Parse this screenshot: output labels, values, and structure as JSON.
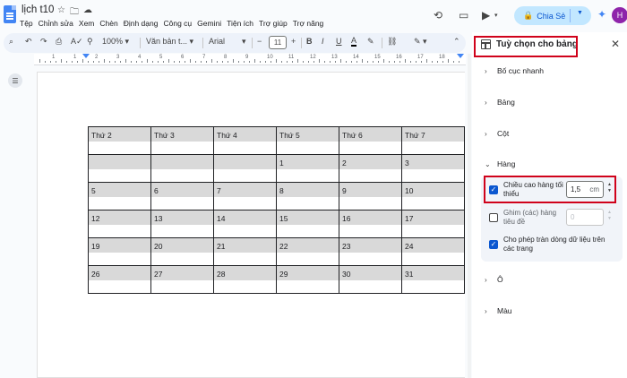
{
  "title_bar": {
    "doc_title": "lịch t10",
    "menus": [
      "Tệp",
      "Chỉnh sửa",
      "Xem",
      "Chèn",
      "Định dạng",
      "Công cụ",
      "Gemini",
      "Tiện ích",
      "Trợ giúp",
      "Trợ năng"
    ],
    "share_label": "Chia Sẻ",
    "avatar_letter": "H"
  },
  "toolbar": {
    "zoom": "100%",
    "style": "Văn bản t...",
    "font": "Arial",
    "font_size": "11",
    "minus": "−",
    "plus": "+"
  },
  "ruler": {
    "numbers": [
      "1",
      "1",
      "2",
      "3",
      "4",
      "5",
      "6",
      "7",
      "8",
      "9",
      "10",
      "11",
      "12",
      "13",
      "14",
      "15",
      "16",
      "17",
      "18"
    ]
  },
  "calendar": {
    "rows": [
      [
        "Thứ 2",
        "Thứ 3",
        "Thứ 4",
        "Thứ 5",
        "Thứ 6",
        "Thứ 7"
      ],
      [
        "",
        "",
        "",
        "1",
        "2",
        "3"
      ],
      [
        "5",
        "6",
        "7",
        "8",
        "9",
        "10"
      ],
      [
        "12",
        "13",
        "14",
        "15",
        "16",
        "17"
      ],
      [
        "19",
        "20",
        "21",
        "22",
        "23",
        "24"
      ],
      [
        "26",
        "27",
        "28",
        "29",
        "30",
        "31"
      ]
    ]
  },
  "panel": {
    "title": "Tuỳ chọn cho bảng",
    "sections": {
      "quick_layout": "Bố cục nhanh",
      "table": "Bảng",
      "column": "Cột",
      "row": "Hàng",
      "cell": "Ô",
      "color": "Màu"
    },
    "row_options": {
      "min_height_label_1": "Chiều cao hàng tối",
      "min_height_label_2": "thiểu",
      "min_height_value": "1,5",
      "min_height_unit": "cm",
      "pin_label_1": "Ghim (các) hàng",
      "pin_label_2": "tiêu đề",
      "pin_value": "0",
      "overflow_label_1": "Cho phép tràn dòng dữ liệu trên",
      "overflow_label_2": "các trang"
    }
  },
  "colors": {
    "accent": "#0b57d0",
    "highlight": "#d0021b",
    "share_bg": "#c2e7ff",
    "cell_band": "#d9d9d9"
  }
}
